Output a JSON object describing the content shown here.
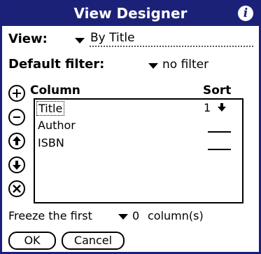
{
  "dialog": {
    "title": "View Designer",
    "info_icon": "info-icon"
  },
  "view": {
    "label": "View:",
    "value": "By Title"
  },
  "filter": {
    "label": "Default filter:",
    "value": "no filter"
  },
  "side_buttons": [
    "plus-icon",
    "minus-icon",
    "arrow-up-icon",
    "arrow-down-icon",
    "x-icon"
  ],
  "columns": {
    "header_column": "Column",
    "header_sort": "Sort",
    "items": [
      {
        "label": "Title",
        "sort": "1",
        "sort_dir": "descending"
      },
      {
        "label": "Author",
        "sort": ""
      },
      {
        "label": "ISBN",
        "sort": ""
      }
    ]
  },
  "freeze": {
    "label": "Freeze the first",
    "value": "0",
    "suffix": "column(s)"
  },
  "buttons": {
    "ok": "OK",
    "cancel": "Cancel"
  },
  "colors": {
    "titlebar": "#1c2178"
  }
}
